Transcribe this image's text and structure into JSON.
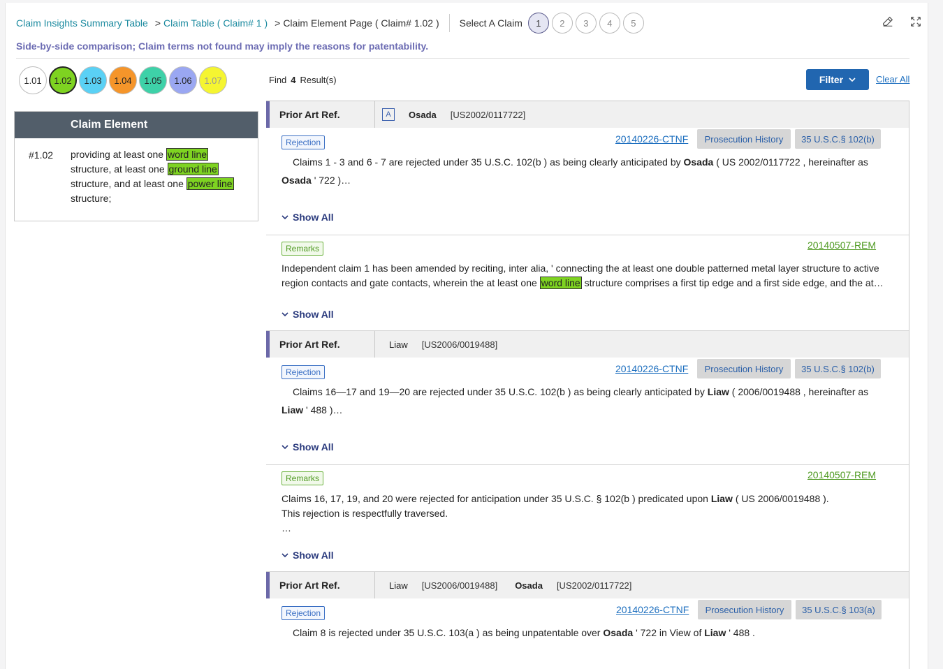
{
  "breadcrumb": {
    "items": [
      "Claim Insights Summary Table",
      "Claim Table ( Claim# 1 )"
    ],
    "separator": ">",
    "current": "Claim Element Page ( Claim# 1.02 )"
  },
  "claim_selector": {
    "label": "Select A Claim",
    "options": [
      "1",
      "2",
      "3",
      "4",
      "5"
    ],
    "selected": "1"
  },
  "subtitle": "Side-by-side comparison; Claim terms not found may imply the reasons for patentability.",
  "elements": [
    {
      "label": "1.01",
      "color": "#ffffff"
    },
    {
      "label": "1.02",
      "color": "#7ed321"
    },
    {
      "label": "1.03",
      "color": "#5ad1f5"
    },
    {
      "label": "1.04",
      "color": "#f5952a"
    },
    {
      "label": "1.05",
      "color": "#3ed1a8"
    },
    {
      "label": "1.06",
      "color": "#9aa7f2"
    },
    {
      "label": "1.07",
      "color": "#f5f531"
    }
  ],
  "find": {
    "prefix": "Find",
    "count": "4",
    "suffix": "Result(s)"
  },
  "filter_label": "Filter",
  "clear_all_label": "Clear All",
  "claim_element": {
    "header": "Claim Element",
    "number": "#1.02",
    "parts": [
      "providing at least one ",
      "word line",
      " structure, at least one ",
      "ground line",
      " structure, and at least one ",
      "power line",
      " structure;"
    ]
  },
  "prior_art_label": "Prior Art Ref.",
  "groups": [
    {
      "prior_art": {
        "badge": "A",
        "refs": [
          {
            "name": "Osada",
            "number": "[US2002/0117722]"
          }
        ]
      },
      "rejection": {
        "tag": "Rejection",
        "doc": "20140226-CTNF",
        "btn1": "Prosecution History",
        "btn2": "35 U.S.C.§ 102(b)",
        "text1": "Claims 1 - 3 and 6 - 7 are rejected under 35 U.S.C. 102(b ) as being clearly anticipated by ",
        "bold1": "Osada",
        "text2": " ( US 2002/0117722 , hereinafter as",
        "bold2": "Osada",
        "text3": " ' 722 )…"
      },
      "remarks": {
        "tag": "Remarks",
        "doc": "20140507-REM",
        "text1": "Independent claim 1 has been amended by reciting, inter alia, ' connecting the at least one double patterned metal layer structure to active region contacts and gate contacts, wherein the at least one ",
        "hl": "word line",
        "text2": " structure comprises a first tip edge and a first side edge, and the at…"
      }
    },
    {
      "prior_art": {
        "refs": [
          {
            "name": "Liaw",
            "number": "[US2006/0019488]"
          }
        ]
      },
      "rejection": {
        "tag": "Rejection",
        "doc": "20140226-CTNF",
        "btn1": "Prosecution History",
        "btn2": "35 U.S.C.§ 102(b)",
        "text1": "Claims 16—17 and 19—20 are rejected under 35 U.S.C. 102(b ) as being clearly anticipated by ",
        "bold1": "Liaw",
        "text2": " ( 2006/0019488 , hereinafter as",
        "bold2": "Liaw",
        "text3": " ' 488 )…"
      },
      "remarks": {
        "tag": "Remarks",
        "doc": "20140507-REM",
        "text1": "Claims 16, 17, 19, and 20 were rejected for anticipation under 35 U.S.C. § 102(b ) predicated upon ",
        "bold1": "Liaw",
        "text2": " ( US 2006/0019488 ).",
        "line2": "This rejection is respectfully traversed.",
        "line3": "…"
      }
    },
    {
      "prior_art": {
        "refs": [
          {
            "name": "Liaw",
            "number": "[US2006/0019488]"
          },
          {
            "name": "Osada",
            "number": "[US2002/0117722]"
          }
        ]
      },
      "rejection": {
        "tag": "Rejection",
        "doc": "20140226-CTNF",
        "btn1": "Prosecution History",
        "btn2": "35 U.S.C.§ 103(a)",
        "text1": "Claim 8 is rejected under 35 U.S.C. 103(a ) as being unpatentable over ",
        "bold1": "Osada",
        "text2": " ' 722 in View of ",
        "bold2": "Liaw",
        "text3": " ' 488 ."
      }
    }
  ],
  "show_all_label": "Show All"
}
